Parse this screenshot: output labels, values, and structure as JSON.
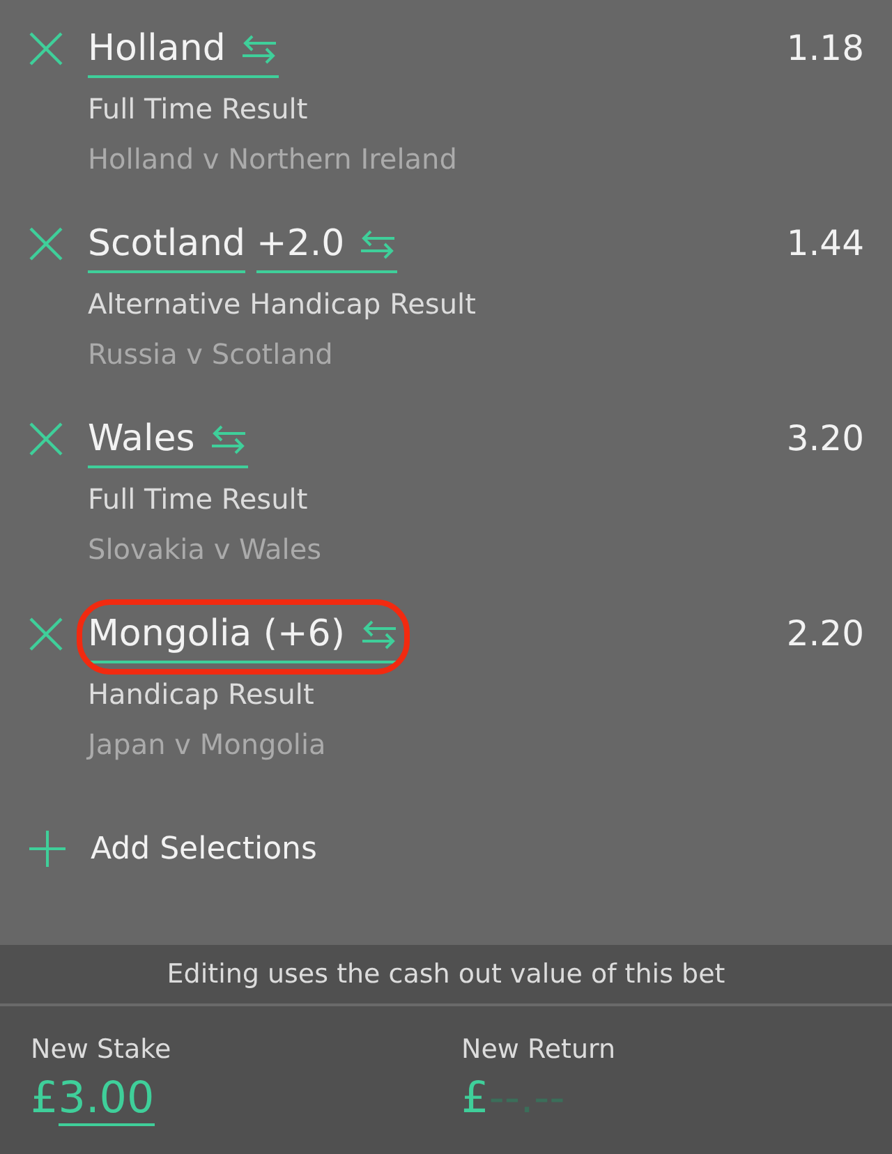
{
  "selections": [
    {
      "name_parts": [
        "Holland"
      ],
      "odds": "1.18",
      "market": "Full Time Result",
      "event": "Holland v Northern Ireland",
      "highlighted": false
    },
    {
      "name_parts": [
        "Scotland",
        "+2.0"
      ],
      "odds": "1.44",
      "market": "Alternative Handicap Result",
      "event": "Russia v Scotland",
      "highlighted": false
    },
    {
      "name_parts": [
        "Wales"
      ],
      "odds": "3.20",
      "market": "Full Time Result",
      "event": "Slovakia v Wales",
      "highlighted": false
    },
    {
      "name_parts": [
        "Mongolia (+6)"
      ],
      "odds": "2.20",
      "market": "Handicap Result",
      "event": "Japan v Mongolia",
      "highlighted": true
    }
  ],
  "add_selections": "Add Selections",
  "notice": "Editing uses the cash out value of this bet",
  "new_stake": {
    "label": "New Stake",
    "currency": "£",
    "value": "3.00"
  },
  "new_return": {
    "label": "New Return",
    "currency": "£",
    "value": "--.--"
  }
}
